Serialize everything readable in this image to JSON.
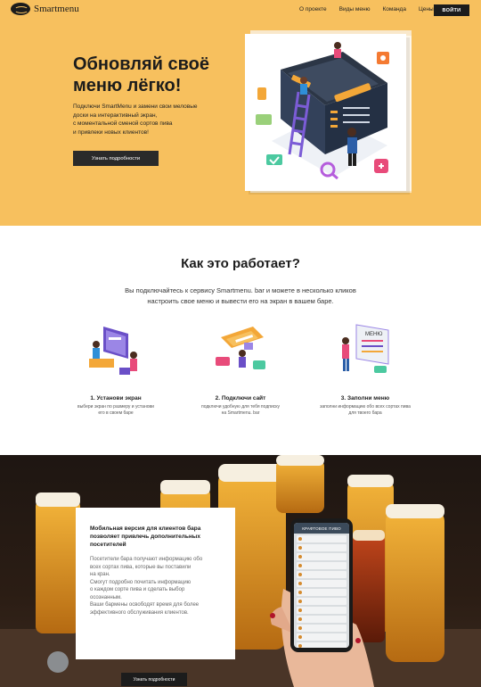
{
  "header": {
    "logo_text": "Smartmenu",
    "nav": [
      "О проекте",
      "Виды меню",
      "Команда",
      "Цены"
    ],
    "login": "ВОЙТИ"
  },
  "hero": {
    "title": "Обновляй своё меню лёгко!",
    "subtitle": "Подключи SmartMenu и замени свои меловые\nдоски на интерактивный экран,\nс моментальной сменой сортов пива\nи привлеки новых клиентов!",
    "button": "Узнать подробности"
  },
  "how": {
    "title": "Как это работает?",
    "subtitle": "Вы подключайтесь к сервису Smartmenu. bar и можете в несколько кликов\nнастроить свое меню и вывести его на экран в вашем баре.",
    "steps": [
      {
        "title": "1. Установи экран",
        "desc": "выбери экран по размеру и установи\nего в своем баре"
      },
      {
        "title": "2. Подключи сайт",
        "desc": "подключи удобную для тебя подписку\nна Smartmenu. bar"
      },
      {
        "title": "3. Заполни меню",
        "desc": "заполни информацию обо всех сортах пива\nдля твоего бара"
      }
    ],
    "menu_word": "МЕНЮ"
  },
  "mobile": {
    "title": "Мобильная версия для клиентов бара\nпозволяет привлечь дополнительных\nпосетителей",
    "body": "Посетители бара получают информацию обо\nвсех сортах пива, которые вы поставили\nна кран.\nСмогут подробно почитать информацию\nо каждом сорте пива и сделать выбор\nосознанным.\nВаши бармены освободят время для более\nэффективного обслуживания клиентов.",
    "button": "Узнать подробности",
    "phone_title": "КРАФТОВОЕ ПИВО"
  },
  "colors": {
    "hero_bg": "#f7c05e",
    "dark": "#1c1c1c",
    "accent_purple": "#6a4fc7",
    "accent_pink": "#e84b7a"
  }
}
